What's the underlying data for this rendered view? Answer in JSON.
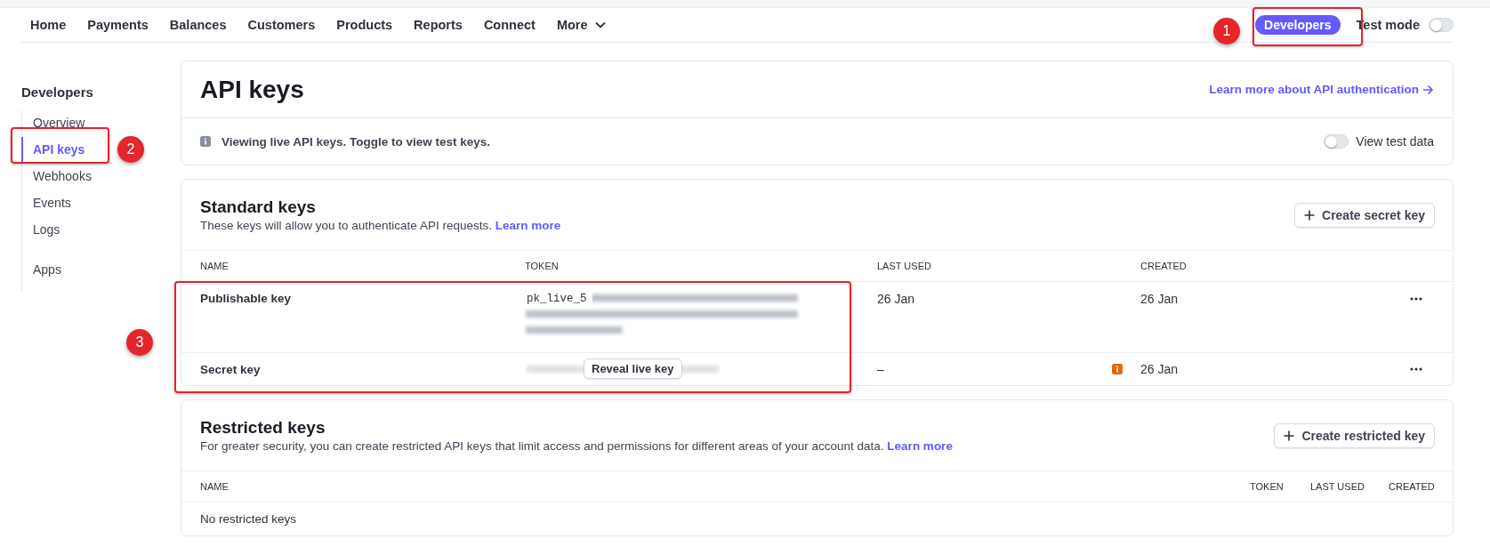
{
  "top_nav": {
    "items": [
      {
        "label": "Home"
      },
      {
        "label": "Payments"
      },
      {
        "label": "Balances"
      },
      {
        "label": "Customers"
      },
      {
        "label": "Products"
      },
      {
        "label": "Reports"
      },
      {
        "label": "Connect"
      },
      {
        "label": "More",
        "menu": true
      }
    ],
    "developers_button": {
      "label": "Developers",
      "selected": true
    },
    "test_mode": {
      "label": "Test mode",
      "on": false
    }
  },
  "sidebar": {
    "title": "Developers",
    "groups": [
      [
        {
          "label": "Overview",
          "selected": false
        },
        {
          "label": "API keys",
          "selected": true
        },
        {
          "label": "Webhooks",
          "selected": false
        },
        {
          "label": "Events",
          "selected": false
        },
        {
          "label": "Logs",
          "selected": false
        }
      ],
      [
        {
          "label": "Apps",
          "selected": false
        }
      ]
    ]
  },
  "api_keys": {
    "title": "API keys",
    "link": "Learn more about API authentication",
    "info": "Viewing live API keys. Toggle to view test keys.",
    "view_test_data": {
      "label": "View test data",
      "on": false
    }
  },
  "standard_keys": {
    "title": "Standard keys",
    "description": "These keys will allow you to authenticate API requests.",
    "learn_more": "Learn more",
    "button": "Create secret key",
    "columns": [
      "NAME",
      "TOKEN",
      "LAST USED",
      "CREATED"
    ],
    "rows": [
      {
        "kind": "visible",
        "name": "Publishable key",
        "token": "pk_live_5",
        "last_used": "26 Jan",
        "warning": false,
        "created": "26 Jan"
      },
      {
        "kind": "concealed",
        "name": "Secret key",
        "reveal_button": "Reveal live key",
        "last_used": "–",
        "warning": true,
        "created": "26 Jan"
      }
    ]
  },
  "restricted_keys": {
    "title": "Restricted keys",
    "description": "For greater security, you can create restricted API keys that limit access and permissions for different areas of your account data.",
    "learn_more": "Learn more",
    "button": "Create restricted key",
    "columns": [
      "NAME",
      "TOKEN",
      "LAST USED",
      "CREATED"
    ],
    "empty": "No restricted keys"
  },
  "annotations": [
    {
      "label": "1"
    },
    {
      "label": "2"
    },
    {
      "label": "3"
    }
  ]
}
